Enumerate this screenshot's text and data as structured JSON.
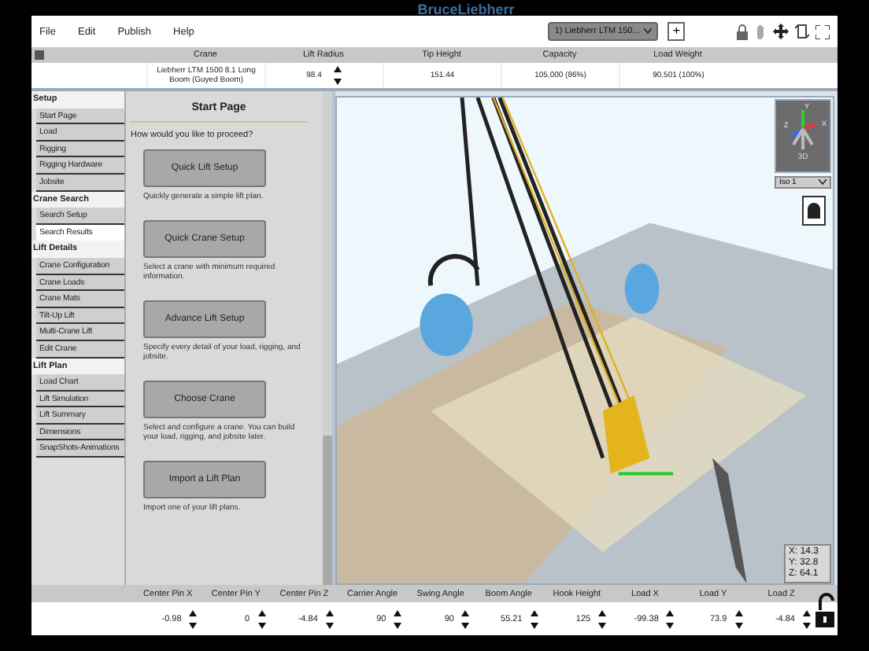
{
  "app_title": "BruceLiebherr",
  "menu": [
    "File",
    "Edit",
    "Publish",
    "Help"
  ],
  "crane_select": {
    "value": "1) Liebherr LTM 150..."
  },
  "add_button": "+",
  "summary": [
    {
      "label": "Crane",
      "value": "Liebherr LTM 1500 8.1 Long Boom (Guyed Boom)",
      "spinner": false
    },
    {
      "label": "Lift Radius",
      "value": "98.4",
      "spinner": true
    },
    {
      "label": "Tip Height",
      "value": "151.44",
      "spinner": false
    },
    {
      "label": "Capacity",
      "value": "105,000 (86%)",
      "spinner": false
    },
    {
      "label": "Load Weight",
      "value": "90,501 (100%)",
      "spinner": false
    }
  ],
  "sidebar": [
    {
      "title": "Setup",
      "items": [
        {
          "label": "Start Page",
          "selected": false
        },
        {
          "label": "Load",
          "selected": false
        },
        {
          "label": "Rigging",
          "selected": false
        },
        {
          "label": "Rigging Hardware",
          "selected": false
        },
        {
          "label": "Jobsite",
          "selected": false
        }
      ]
    },
    {
      "title": "Crane Search",
      "items": [
        {
          "label": "Search Setup",
          "selected": false
        },
        {
          "label": "Search Results",
          "selected": true
        }
      ]
    },
    {
      "title": "Lift Details",
      "items": [
        {
          "label": "Crane Configuration",
          "selected": false
        },
        {
          "label": "Crane Loads",
          "selected": false
        },
        {
          "label": "Crane Mats",
          "selected": false
        },
        {
          "label": "Tilt-Up Lift",
          "selected": false
        },
        {
          "label": "Multi-Crane Lift",
          "selected": false
        },
        {
          "label": "Edit Crane",
          "selected": false
        }
      ]
    },
    {
      "title": "Lift Plan",
      "items": [
        {
          "label": "Load Chart",
          "selected": false
        },
        {
          "label": "Lift Simulation",
          "selected": false
        },
        {
          "label": "Lift Summary",
          "selected": false
        },
        {
          "label": "Dimensions",
          "selected": false
        },
        {
          "label": "SnapShots-Animations",
          "selected": false
        }
      ]
    }
  ],
  "start_page": {
    "title": "Start Page",
    "prompt": "How would you like to proceed?",
    "options": [
      {
        "button": "Quick Lift Setup",
        "description": "Quickly generate a simple lift plan."
      },
      {
        "button": "Quick Crane Setup",
        "description": "Select a crane with minimum required information."
      },
      {
        "button": "Advance Lift Setup",
        "description": "Specify every detail of your load, rigging, and jobsite."
      },
      {
        "button": "Choose Crane",
        "description": "Select and configure a crane. You can build your load, rigging, and jobsite later."
      },
      {
        "button": "Import a Lift Plan",
        "description": "Import one of your lift plans."
      }
    ]
  },
  "view": {
    "gizmo_axes": [
      "Y",
      "Z",
      "X"
    ],
    "gizmo_label": "3D",
    "view_select": "Iso 1",
    "coordinates": [
      "X: 14.3",
      "Y: 32.8",
      "Z: 64.1"
    ]
  },
  "params": [
    {
      "label": "Center Pin X",
      "value": "-0.98"
    },
    {
      "label": "Center Pin Y",
      "value": "0"
    },
    {
      "label": "Center Pin Z",
      "value": "-4.84"
    },
    {
      "label": "Carrier Angle",
      "value": "90"
    },
    {
      "label": "Swing Angle",
      "value": "90"
    },
    {
      "label": "Boom Angle",
      "value": "55.21"
    },
    {
      "label": "Hook Height",
      "value": "125"
    },
    {
      "label": "Load X",
      "value": "-99.38"
    },
    {
      "label": "Load Y",
      "value": "73.9"
    },
    {
      "label": "Load Z",
      "value": "-4.84"
    }
  ]
}
